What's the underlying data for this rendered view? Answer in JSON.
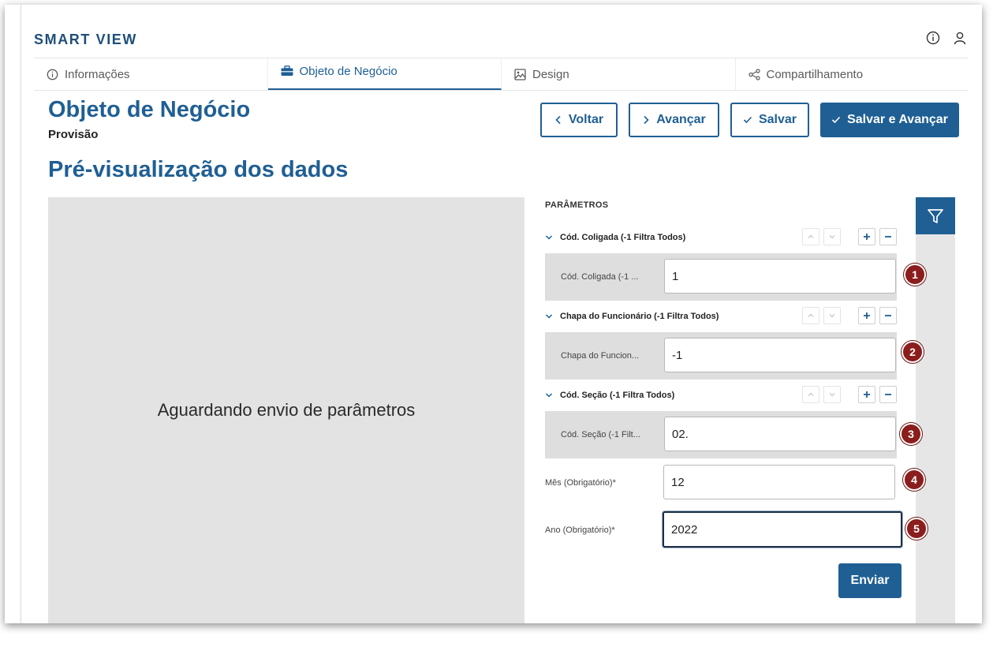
{
  "app": {
    "brand": "SMART VIEW"
  },
  "header_icons": [
    "info-icon",
    "user-icon"
  ],
  "tabs": [
    {
      "label": "Informações",
      "icon": "info-icon",
      "active": false
    },
    {
      "label": "Objeto de Negócio",
      "icon": "briefcase-icon",
      "active": true
    },
    {
      "label": "Design",
      "icon": "image-icon",
      "active": false
    },
    {
      "label": "Compartilhamento",
      "icon": "share-icon",
      "active": false
    }
  ],
  "page": {
    "title": "Objeto de Negócio",
    "subtitle": "Provisão",
    "section_title": "Pré-visualização dos dados"
  },
  "actions": {
    "back": "Voltar",
    "next": "Avançar",
    "save": "Salvar",
    "save_next": "Salvar e Avançar"
  },
  "preview": {
    "placeholder": "Aguardando envio de parâmetros"
  },
  "params": {
    "heading": "PARÂMETROS",
    "groups": [
      {
        "title": "Cód. Coligada (-1 Filtra Todos)",
        "field_label": "Cód. Coligada (-1 ...",
        "value": "1",
        "badge": "1"
      },
      {
        "title": "Chapa do Funcionário (-1 Filtra Todos)",
        "field_label": "Chapa do Funcion...",
        "value": "-1",
        "badge": "2"
      },
      {
        "title": "Cód. Seção (-1 Filtra Todos)",
        "field_label": "Cód. Seção (-1 Filt...",
        "value": "02.",
        "badge": "3"
      }
    ],
    "month": {
      "label": "Mês (Obrigatório)*",
      "value": "12",
      "badge": "4"
    },
    "year": {
      "label": "Ano (Obrigatório)*",
      "value": "2022",
      "badge": "5"
    },
    "submit": "Enviar"
  },
  "colors": {
    "primary": "#1f5f94",
    "badge": "#8b1d1d",
    "panel_gray": "#e3e3e3"
  }
}
